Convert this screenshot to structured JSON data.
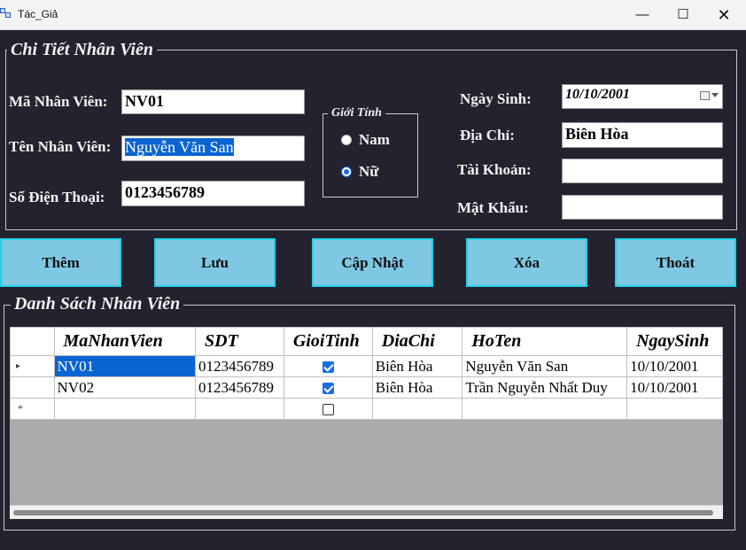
{
  "window": {
    "title": "Tác_Giả",
    "min": "—",
    "max": "☐",
    "close": "✕"
  },
  "details": {
    "legend": "Chi Tiết Nhân Viên",
    "ma_label": "Mã Nhân Viên:",
    "ma_value": "NV01",
    "ten_label": "Tên Nhân Viên:",
    "ten_value": "Nguyễn Văn San",
    "sdt_label": "Số Điện Thoại:",
    "sdt_value": "0123456789",
    "gender": {
      "legend": "Giới Tính",
      "male": "Nam",
      "female": "Nữ",
      "selected": "Nữ"
    },
    "ngaysinh_label": "Ngày Sinh:",
    "ngaysinh_value": "10/10/2001",
    "diachi_label": "Địa Chỉ:",
    "diachi_value": "Biên Hòa",
    "taikhoan_label": "Tài Khoản:",
    "taikhoan_value": "",
    "matkhau_label": "Mật Khẩu:",
    "matkhau_value": ""
  },
  "buttons": {
    "them": "Thêm",
    "luu": "Lưu",
    "capnhat": "Cập Nhật",
    "xoa": "Xóa",
    "thoat": "Thoát"
  },
  "list": {
    "legend": "Danh Sách Nhân Viên",
    "columns": [
      "MaNhanVien",
      "SDT",
      "GioiTinh",
      "DiaChi",
      "HoTen",
      "NgaySinh"
    ],
    "rows": [
      {
        "MaNhanVien": "NV01",
        "SDT": "0123456789",
        "GioiTinh": true,
        "DiaChi": "Biên Hòa",
        "HoTen": "Nguyễn Văn San",
        "NgaySinh": "10/10/2001"
      },
      {
        "MaNhanVien": "NV02",
        "SDT": "0123456789",
        "GioiTinh": true,
        "DiaChi": "Biên Hòa",
        "HoTen": "Trần Nguyễn Nhất Duy",
        "NgaySinh": "10/10/2001"
      }
    ],
    "current_row_marker": "▸",
    "new_row_marker": "*"
  }
}
